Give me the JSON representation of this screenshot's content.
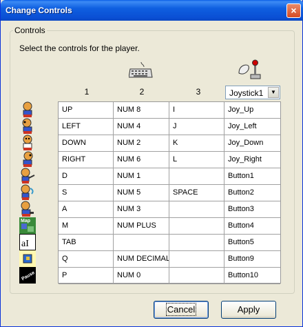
{
  "window": {
    "title": "Change Controls",
    "close_label": "×"
  },
  "group": {
    "legend": "Controls",
    "instruction": "Select the controls for the player.",
    "columns": [
      "1",
      "2",
      "3"
    ],
    "joystick": {
      "selected": "Joystick1",
      "arrow": "▼"
    }
  },
  "rows": [
    {
      "icon": "walk-up-icon",
      "c": [
        "UP",
        "NUM 8",
        "I",
        "Joy_Up"
      ]
    },
    {
      "icon": "walk-left-icon",
      "c": [
        "LEFT",
        "NUM 4",
        "J",
        "Joy_Left"
      ]
    },
    {
      "icon": "walk-down-icon",
      "c": [
        "DOWN",
        "NUM 2",
        "K",
        "Joy_Down"
      ]
    },
    {
      "icon": "walk-right-icon",
      "c": [
        "RIGHT",
        "NUM 6",
        "L",
        "Joy_Right"
      ]
    },
    {
      "icon": "action-1-icon",
      "c": [
        "D",
        "NUM 1",
        "",
        "Button1"
      ]
    },
    {
      "icon": "action-2-icon",
      "c": [
        "S",
        "NUM 5",
        "SPACE",
        "Button2"
      ]
    },
    {
      "icon": "action-3-icon",
      "c": [
        "A",
        "NUM 3",
        "",
        "Button3"
      ]
    },
    {
      "icon": "map-icon",
      "c": [
        "M",
        "NUM PLUS",
        "",
        "Button4"
      ]
    },
    {
      "icon": "text-icon",
      "c": [
        "TAB",
        "",
        "",
        "Button5"
      ]
    },
    {
      "icon": "inventory-icon",
      "c": [
        "Q",
        "NUM DECIMAL",
        "",
        "Button9"
      ]
    },
    {
      "icon": "pause-icon",
      "c": [
        "P",
        "NUM 0",
        "",
        "Button10"
      ]
    }
  ],
  "row_icon_labels": {
    "map": "Map",
    "text": "aI",
    "pause": "Pause"
  },
  "buttons": {
    "cancel": "Cancel",
    "apply": "Apply"
  },
  "colors": {
    "title_bar": "#0a5fe6",
    "dialog_bg": "#ece9d8",
    "close": "#d64a22"
  }
}
